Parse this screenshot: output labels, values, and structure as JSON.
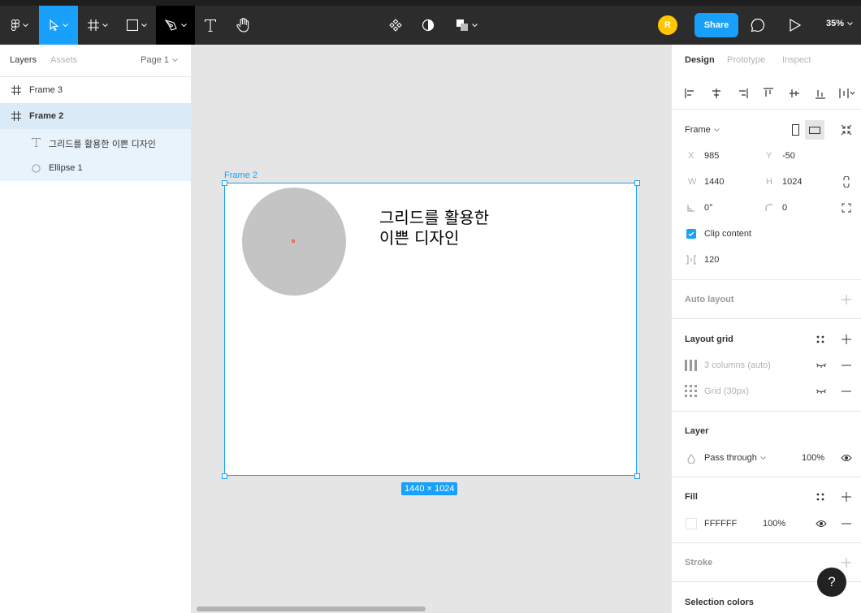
{
  "toolbar": {
    "tools": [
      "figma-menu",
      "move-tool",
      "frame-tool",
      "shape-tool",
      "pen-tool",
      "text-tool",
      "hand-tool"
    ],
    "center_tools": [
      "component",
      "mask",
      "boolean"
    ],
    "avatar_initial": "R",
    "share_label": "Share",
    "zoom_label": "35%"
  },
  "left_panel": {
    "tabs": [
      "Layers",
      "Assets"
    ],
    "page_label": "Page 1",
    "layers": [
      {
        "name": "Frame 3",
        "icon": "frame-icon"
      },
      {
        "name": "Frame 2",
        "icon": "frame-icon"
      },
      {
        "name": "그리드를 활용한 이쁜 디자인",
        "icon": "text-layer-icon"
      },
      {
        "name": "Ellipse 1",
        "icon": "ellipse-layer-icon"
      }
    ]
  },
  "canvas": {
    "frame_label": "Frame 2",
    "text_line1": "그리드를 활용한",
    "text_line2": "이쁜 디자인",
    "size_badge": "1440 × 1024"
  },
  "right_panel": {
    "tabs": [
      "Design",
      "Prototype",
      "Inspect"
    ],
    "frame_section": {
      "title": "Frame",
      "x_label": "X",
      "x_value": "985",
      "y_label": "Y",
      "y_value": "-50",
      "w_label": "W",
      "w_value": "1440",
      "h_label": "H",
      "h_value": "1024",
      "rotation": "0°",
      "radius": "0",
      "clip_label": "Clip content",
      "spacing": "120"
    },
    "auto_layout": "Auto layout",
    "layout_grid": {
      "title": "Layout grid",
      "items": [
        "3 columns (auto)",
        "Grid (30px)"
      ]
    },
    "layer": {
      "title": "Layer",
      "blend": "Pass through",
      "opacity": "100%"
    },
    "fill": {
      "title": "Fill",
      "color": "FFFFFF",
      "opacity": "100%"
    },
    "stroke": "Stroke",
    "selection_colors": "Selection colors"
  },
  "help_label": "?",
  "colors": {
    "accent": "#18a0fb",
    "toolbar_bg": "#2c2c2c",
    "avatar": "#ffc700",
    "ellipse": "#c4c4c4"
  }
}
